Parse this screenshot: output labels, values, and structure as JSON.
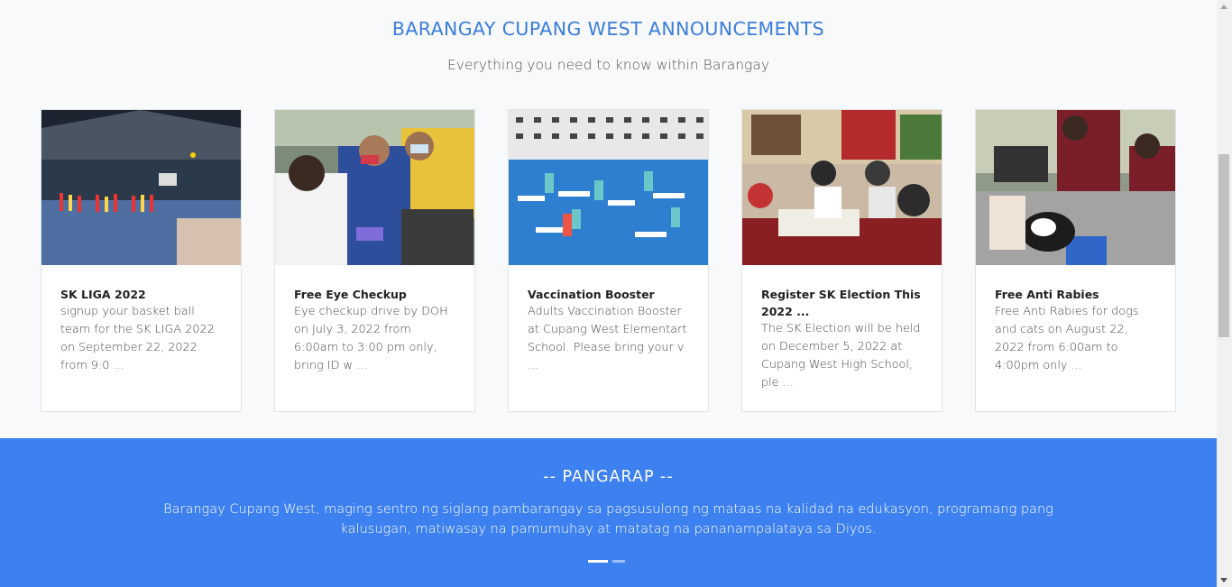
{
  "header": {
    "title": "BARANGAY CUPANG WEST ANNOUNCEMENTS",
    "subtitle": "Everything you need to know within Barangay"
  },
  "cards": [
    {
      "title": "SK LIGA 2022",
      "text": "signup your basket ball team for the SK LIGA 2022 on September 22, 2022 from 9:0 ...",
      "image": "basketball-court-photo"
    },
    {
      "title": "Free Eye Checkup",
      "text": "Eye checkup drive by DOH on July 3, 2022 from 6:00am to 3:00 pm only, bring ID w ...",
      "image": "eye-checkup-photo"
    },
    {
      "title": "Vaccination Booster",
      "text": "Adults Vaccination Booster at Cupang West Elementart School. Please bring your v ...",
      "image": "vaccination-hall-photo"
    },
    {
      "title": "Register SK Election This 2022 ...",
      "text": "The SK Election will be held on December 5, 2022 at Cupang West High School, ple ...",
      "image": "registration-photo"
    },
    {
      "title": "Free Anti Rabies",
      "text": "Free Anti Rabies for dogs and cats on August 22, 2022 from 6:00am to 4:00pm only ...",
      "image": "anti-rabies-photo"
    }
  ],
  "band": {
    "title": "-- PANGARAP --",
    "text": "Barangay Cupang West, maging sentro ng siglang pambarangay sa pagsusulong ng mataas na kalidad na edukasyon, programang pang kalusugan, matiwasay na pamumuhay at matatag na pananampalataya sa Diyos.",
    "slides": 2,
    "active_slide": 1
  },
  "colors": {
    "accent": "#3b7ddd",
    "band": "#3d80f0"
  }
}
